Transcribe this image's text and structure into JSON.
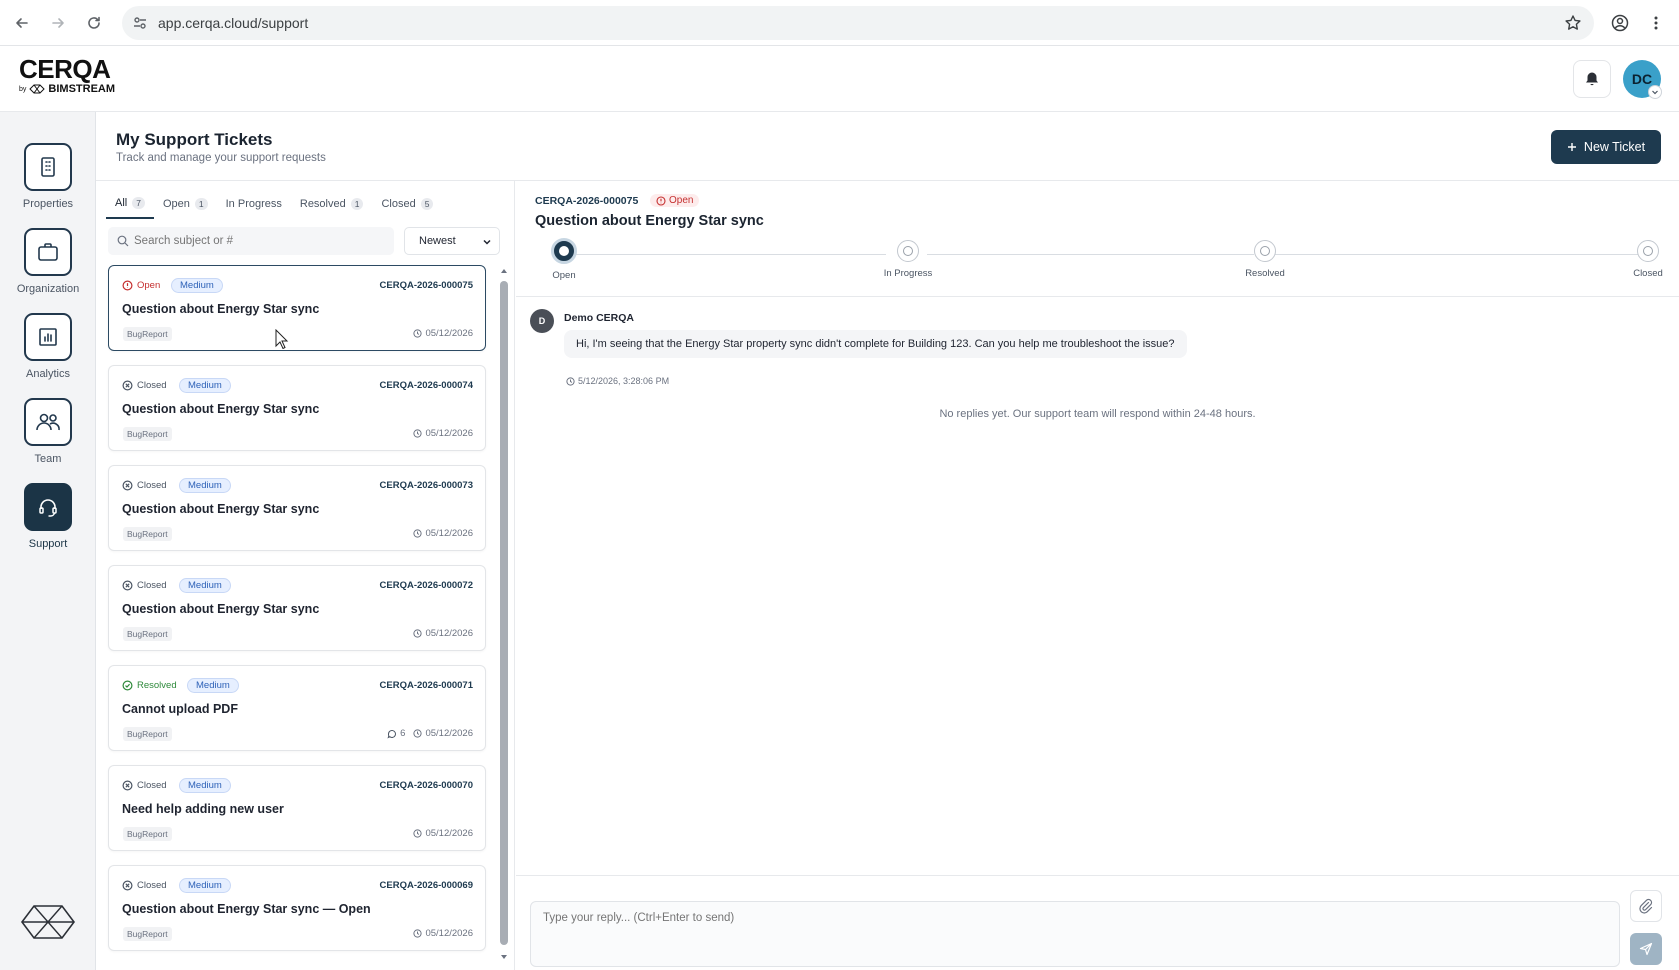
{
  "browser": {
    "url": "app.cerqa.cloud/support"
  },
  "brand": {
    "name": "CERQA",
    "by": "by",
    "partner": "BIMSTREAM"
  },
  "user": {
    "initials": "DC"
  },
  "sidebar": {
    "items": [
      {
        "label": "Properties",
        "icon": "clipboard-icon",
        "active": false
      },
      {
        "label": "Organization",
        "icon": "briefcase-icon",
        "active": false
      },
      {
        "label": "Analytics",
        "icon": "bar-chart-icon",
        "active": false
      },
      {
        "label": "Team",
        "icon": "users-icon",
        "active": false
      },
      {
        "label": "Support",
        "icon": "headset-icon",
        "active": true
      }
    ]
  },
  "page": {
    "title": "My Support Tickets",
    "subtitle": "Track and manage your support requests",
    "new_ticket_label": "New Ticket"
  },
  "tabs": [
    {
      "label": "All",
      "count": "7",
      "active": true
    },
    {
      "label": "Open",
      "count": "1",
      "active": false
    },
    {
      "label": "In Progress",
      "count": "",
      "active": false
    },
    {
      "label": "Resolved",
      "count": "1",
      "active": false
    },
    {
      "label": "Closed",
      "count": "5",
      "active": false
    }
  ],
  "search": {
    "placeholder": "Search subject or #",
    "sort_value": "Newest"
  },
  "tickets": [
    {
      "status": "Open",
      "status_type": "open",
      "priority": "Medium",
      "id": "CERQA-2026-000075",
      "title": "Question about Energy Star sync",
      "category": "BugReport",
      "comments": "",
      "date": "05/12/2026",
      "selected": true
    },
    {
      "status": "Closed",
      "status_type": "closed",
      "priority": "Medium",
      "id": "CERQA-2026-000074",
      "title": "Question about Energy Star sync",
      "category": "BugReport",
      "comments": "",
      "date": "05/12/2026",
      "selected": false
    },
    {
      "status": "Closed",
      "status_type": "closed",
      "priority": "Medium",
      "id": "CERQA-2026-000073",
      "title": "Question about Energy Star sync",
      "category": "BugReport",
      "comments": "",
      "date": "05/12/2026",
      "selected": false
    },
    {
      "status": "Closed",
      "status_type": "closed",
      "priority": "Medium",
      "id": "CERQA-2026-000072",
      "title": "Question about Energy Star sync",
      "category": "BugReport",
      "comments": "",
      "date": "05/12/2026",
      "selected": false
    },
    {
      "status": "Resolved",
      "status_type": "resolved",
      "priority": "Medium",
      "id": "CERQA-2026-000071",
      "title": "Cannot upload PDF",
      "category": "BugReport",
      "comments": "6",
      "date": "05/12/2026",
      "selected": false
    },
    {
      "status": "Closed",
      "status_type": "closed",
      "priority": "Medium",
      "id": "CERQA-2026-000070",
      "title": "Need help adding new user",
      "category": "BugReport",
      "comments": "",
      "date": "05/12/2026",
      "selected": false
    },
    {
      "status": "Closed",
      "status_type": "closed",
      "priority": "Medium",
      "id": "CERQA-2026-000069",
      "title": "Question about Energy Star sync — Open",
      "category": "BugReport",
      "comments": "",
      "date": "05/12/2026",
      "selected": false
    }
  ],
  "detail": {
    "id": "CERQA-2026-000075",
    "status": "Open",
    "title": "Question about Energy Star sync",
    "steps": [
      {
        "label": "Open",
        "current": true
      },
      {
        "label": "In Progress",
        "current": false
      },
      {
        "label": "Resolved",
        "current": false
      },
      {
        "label": "Closed",
        "current": false
      }
    ],
    "message": {
      "avatar": "D",
      "author": "Demo CERQA",
      "text": "Hi, I'm seeing that the Energy Star property sync didn't complete for Building 123. Can you help me troubleshoot the issue?",
      "time": "5/12/2026, 3:28:06 PM"
    },
    "no_replies": "No replies yet. Our support team will respond within 24-48 hours.",
    "reply_placeholder": "Type your reply... (Ctrl+Enter to send)"
  },
  "colors": {
    "primary": "#1e3a4f",
    "open": "#c53030",
    "resolved": "#2f8a3c",
    "priority": "#2e62b8",
    "avatar": "#3aa0c9"
  }
}
